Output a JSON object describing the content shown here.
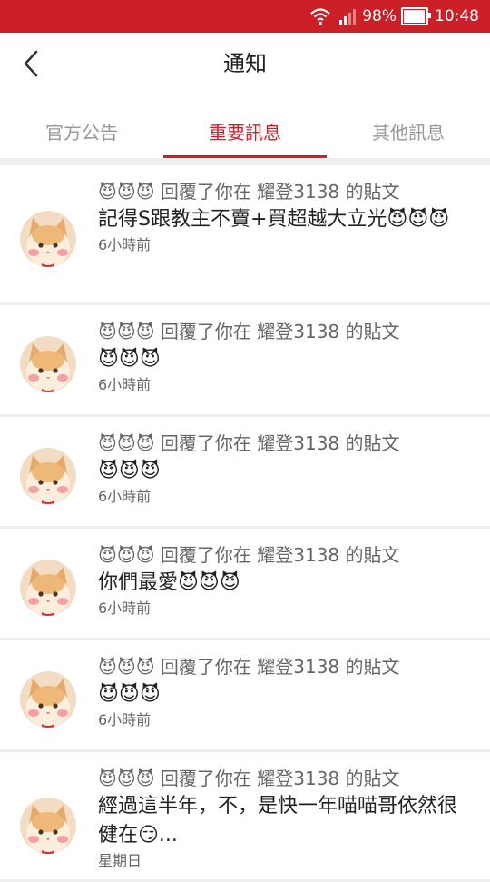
{
  "status_bar": {
    "battery": "98%",
    "time": "10:48",
    "icons": [
      "wifi-icon",
      "signal-icon",
      "battery-icon"
    ]
  },
  "header": {
    "title": "通知",
    "back_icon": "chevron-left-icon"
  },
  "tabs": [
    {
      "label": "官方公告",
      "active": false
    },
    {
      "label": "重要訊息",
      "active": true
    },
    {
      "label": "其他訊息",
      "active": false
    }
  ],
  "colors": {
    "accent": "#cc2028",
    "background": "#eeeeee",
    "muted_text": "#666666",
    "tab_inactive": "#999999"
  },
  "notifications": [
    {
      "avatar": "cat-avatar",
      "head": "😈😈😈 回覆了你在 耀登3138 的貼文",
      "body": "記得S跟教主不賣+買超越大立光😈😈😈",
      "time": "6小時前"
    },
    {
      "avatar": "cat-avatar",
      "head": "😈😈😈 回覆了你在 耀登3138 的貼文",
      "body": "😈😈😈",
      "time": "6小時前"
    },
    {
      "avatar": "cat-avatar",
      "head": "😈😈😈 回覆了你在 耀登3138 的貼文",
      "body": "😈😈😈",
      "time": "6小時前"
    },
    {
      "avatar": "cat-avatar",
      "head": "😈😈😈 回覆了你在 耀登3138 的貼文",
      "body": "你們最愛😈😈😈",
      "time": "6小時前"
    },
    {
      "avatar": "cat-avatar",
      "head": "😈😈😈 回覆了你在 耀登3138 的貼文",
      "body": "😈😈😈",
      "time": "6小時前"
    },
    {
      "avatar": "cat-avatar",
      "head": "😈😈😈 回覆了你在 耀登3138 的貼文",
      "body": "經過這半年，不，是快一年喵喵哥依然很健在😏...",
      "time": "星期日"
    }
  ]
}
